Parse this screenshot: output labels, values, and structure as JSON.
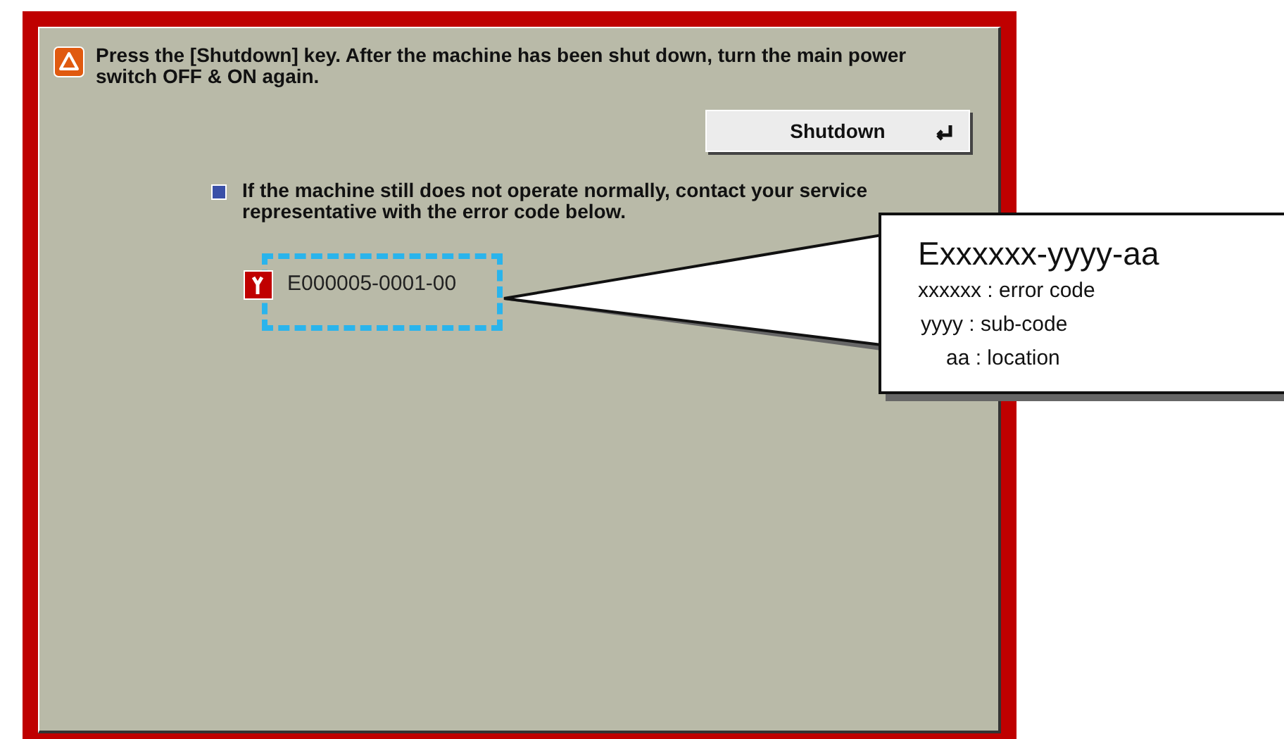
{
  "instruction": "Press the [Shutdown] key. After the machine has been shut down, turn the main power switch OFF & ON again.",
  "shutdown_button": {
    "label": "Shutdown"
  },
  "note": "If the machine still does not operate normally, contact your service representative with the error code below.",
  "error_code": "E000005-0001-00",
  "callout": {
    "title": "Exxxxxx-yyyy-aa",
    "lines": [
      "xxxxxx : error code",
      "yyyy : sub-code",
      "aa : location"
    ]
  }
}
